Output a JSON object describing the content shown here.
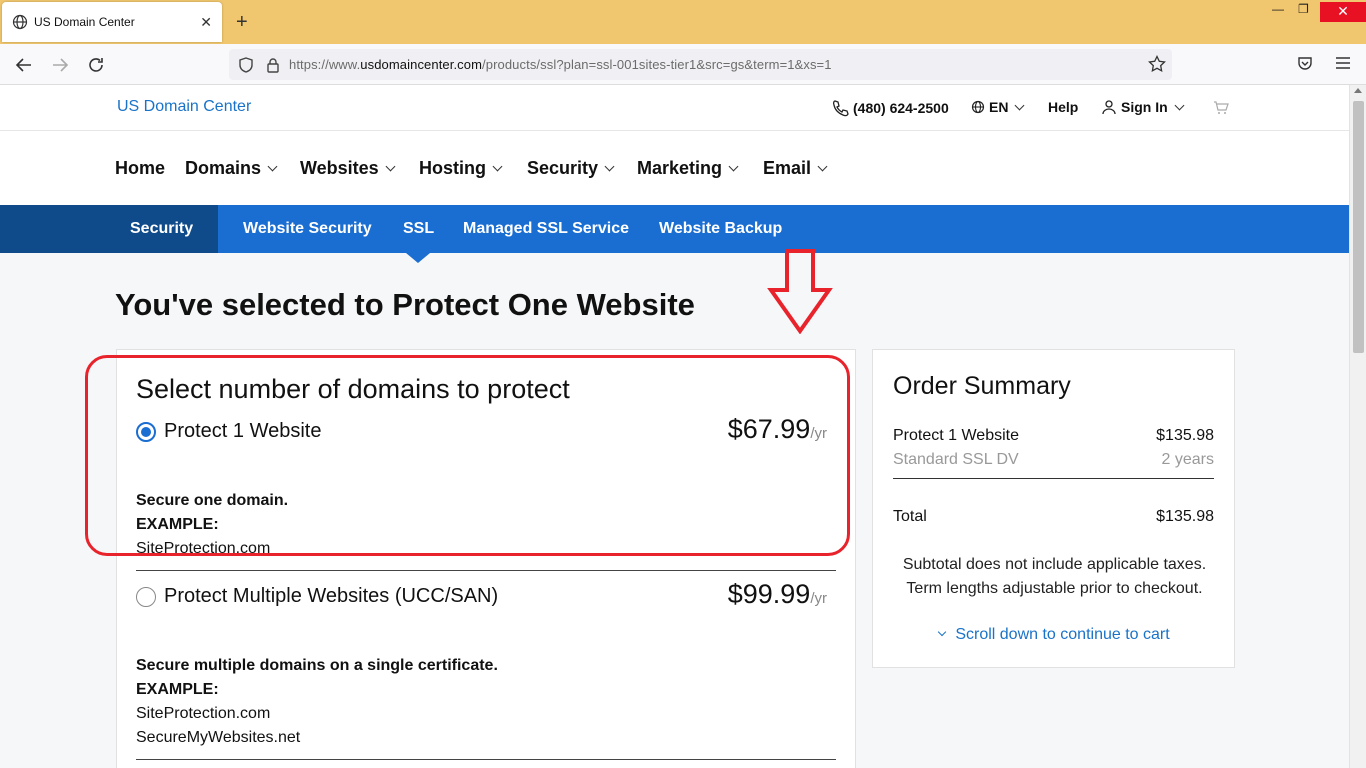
{
  "browser": {
    "tab_title": "US Domain Center",
    "url_prefix": "https://www.",
    "url_domain": "usdomaincenter.com",
    "url_path": "/products/ssl?plan=ssl-001sites-tier1&src=gs&term=1&xs=1",
    "close_glyph": "✕",
    "newtab_glyph": "+",
    "min_glyph": "—",
    "max_glyph": "❐",
    "winclose_glyph": "✕"
  },
  "topbar": {
    "logo": "US Domain Center",
    "phone": "(480) 624-2500",
    "language": "EN",
    "help": "Help",
    "sign_in": "Sign In"
  },
  "mainnav": {
    "items": [
      "Home",
      "Domains",
      "Websites",
      "Hosting",
      "Security",
      "Marketing",
      "Email"
    ]
  },
  "subnav": {
    "section": "Security",
    "items": [
      "Website Security",
      "SSL",
      "Managed SSL Service",
      "Website Backup"
    ]
  },
  "headline": "You've selected to Protect One Website",
  "selector": {
    "title": "Select number of domains to protect",
    "options": [
      {
        "label": "Protect 1 Website",
        "price": "$67.99",
        "per": "/yr",
        "selected": true,
        "description": "Secure one domain.",
        "example_label": "EXAMPLE:",
        "examples": [
          "SiteProtection.com"
        ]
      },
      {
        "label": "Protect Multiple Websites (UCC/SAN)",
        "price": "$99.99",
        "per": "/yr",
        "selected": false,
        "description": "Secure multiple domains on a single certificate.",
        "example_label": "EXAMPLE:",
        "examples": [
          "SiteProtection.com",
          "SecureMyWebsites.net"
        ]
      }
    ]
  },
  "summary": {
    "title": "Order Summary",
    "item_name": "Protect 1 Website",
    "item_price": "$135.98",
    "item_sub": "Standard SSL DV",
    "item_term": "2 years",
    "total_label": "Total",
    "total_value": "$135.98",
    "note_line1": "Subtotal does not include applicable taxes.",
    "note_line2": "Term lengths adjustable prior to checkout.",
    "scroll_link": "Scroll down to continue to cart"
  },
  "colors": {
    "accent": "#1a6dd1",
    "dark_accent": "#0f4a8a",
    "annotation_red": "#e8232c",
    "tabbar": "#f0c66e"
  }
}
